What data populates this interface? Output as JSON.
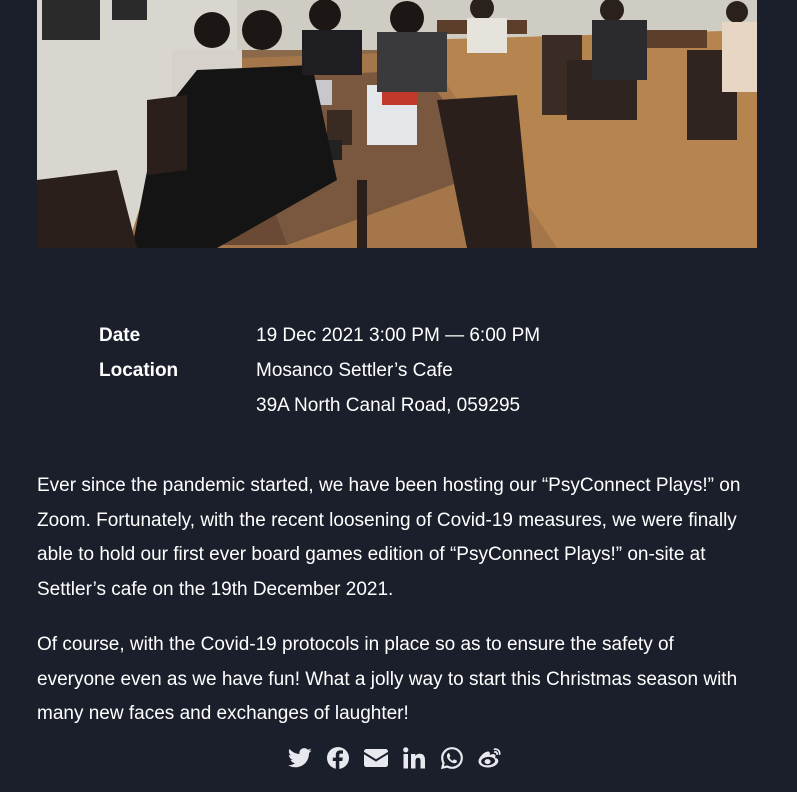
{
  "hero": {
    "image": "photo-people-playing-board-games-in-cafe"
  },
  "details": {
    "date_label": "Date",
    "date_value": "19 Dec 2021 3:00 PM — 6:00 PM",
    "location_label": "Location",
    "location_name": "Mosanco Settler’s Cafe",
    "location_address": "39A North Canal Road, 059295"
  },
  "body": {
    "paragraph_1": "Ever since the pandemic started, we have been hosting our “PsyConnect Plays!” on Zoom. Fortunately, with the recent loosening of Covid-19 measures, we were finally able to hold our first ever board games edition of “PsyConnect Plays!” on-site at Settler’s cafe on the 19th December 2021.",
    "paragraph_2": "Of course, with the Covid-19 protocols in place so as to ensure the safety of everyone even as we have fun! What a jolly way to start this Christmas season with many new faces and exchanges of laughter!"
  },
  "share": {
    "icons": [
      "twitter-icon",
      "facebook-icon",
      "email-icon",
      "linkedin-icon",
      "whatsapp-icon",
      "weibo-icon"
    ],
    "icon_color": "#e7e9ee"
  },
  "colors": {
    "background": "#1b1f2b",
    "text": "#ffffff"
  }
}
